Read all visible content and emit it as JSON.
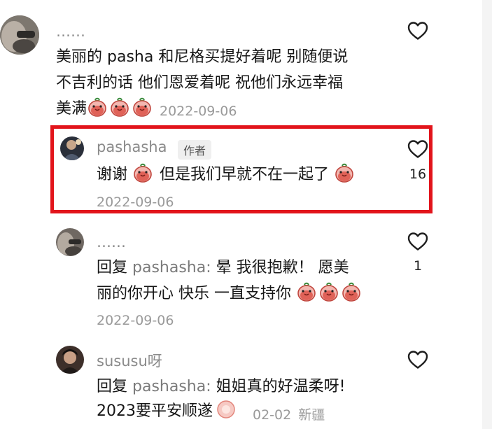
{
  "comments": [
    {
      "username": "……",
      "text_line1": "美丽的 pasha 和尼格买提好着呢 别随便说",
      "text_line2": "不吉利的话 他们恩爱着呢  祝他们永远幸福",
      "text_line3": "美满",
      "date": "2022-09-06",
      "likes": ""
    },
    {
      "username": "pashasha",
      "author_tag": "作者",
      "text_part1": "谢谢",
      "text_part2": "但是我们早就不在一起了",
      "date": "2022-09-06",
      "likes": "16"
    },
    {
      "username": "……",
      "reply_prefix": "回复",
      "reply_to": "pashasha:",
      "text_line1": "晕  我很抱歉！ 愿美",
      "text_line2": "丽的你开心 快乐  一直支持你",
      "date": "2022-09-06",
      "likes": "1"
    },
    {
      "username": "sususu呀",
      "reply_prefix": "回复",
      "reply_to": "pashasha:",
      "text_line1": "姐姐真的好温柔呀!",
      "text_line2": "2023要平安顺遂",
      "date": "02-02",
      "location": "新疆"
    }
  ],
  "colors": {
    "highlight_border": "#e2141b",
    "username": "#8a8a8a",
    "date": "#9a9a9a"
  },
  "icons": {
    "like": "heart-outline-icon",
    "sticker": "red-bean-sticker-icon"
  }
}
